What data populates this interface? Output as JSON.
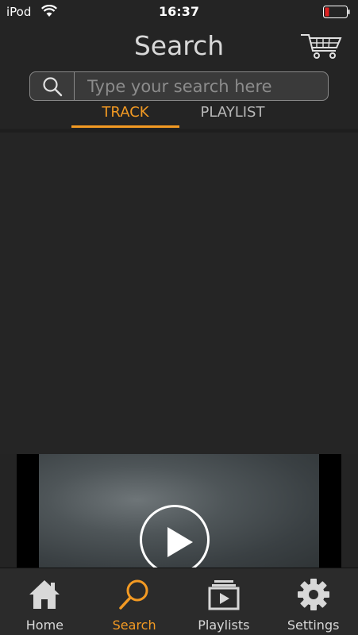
{
  "status_bar": {
    "carrier": "iPod",
    "time": "16:37"
  },
  "header": {
    "title": "Search"
  },
  "search": {
    "placeholder": "Type your search here",
    "value": ""
  },
  "tabs": [
    {
      "label": "TRACK",
      "active": true
    },
    {
      "label": "PLAYLIST",
      "active": false
    }
  ],
  "bottom_nav": [
    {
      "label": "Home",
      "icon": "home-icon",
      "active": false
    },
    {
      "label": "Search",
      "icon": "search-icon",
      "active": true
    },
    {
      "label": "Playlists",
      "icon": "playlists-icon",
      "active": false
    },
    {
      "label": "Settings",
      "icon": "gear-icon",
      "active": false
    }
  ],
  "colors": {
    "accent": "#f39a23",
    "background": "#242424",
    "inactive": "#d8d8d8",
    "battery_low": "#e02020"
  }
}
